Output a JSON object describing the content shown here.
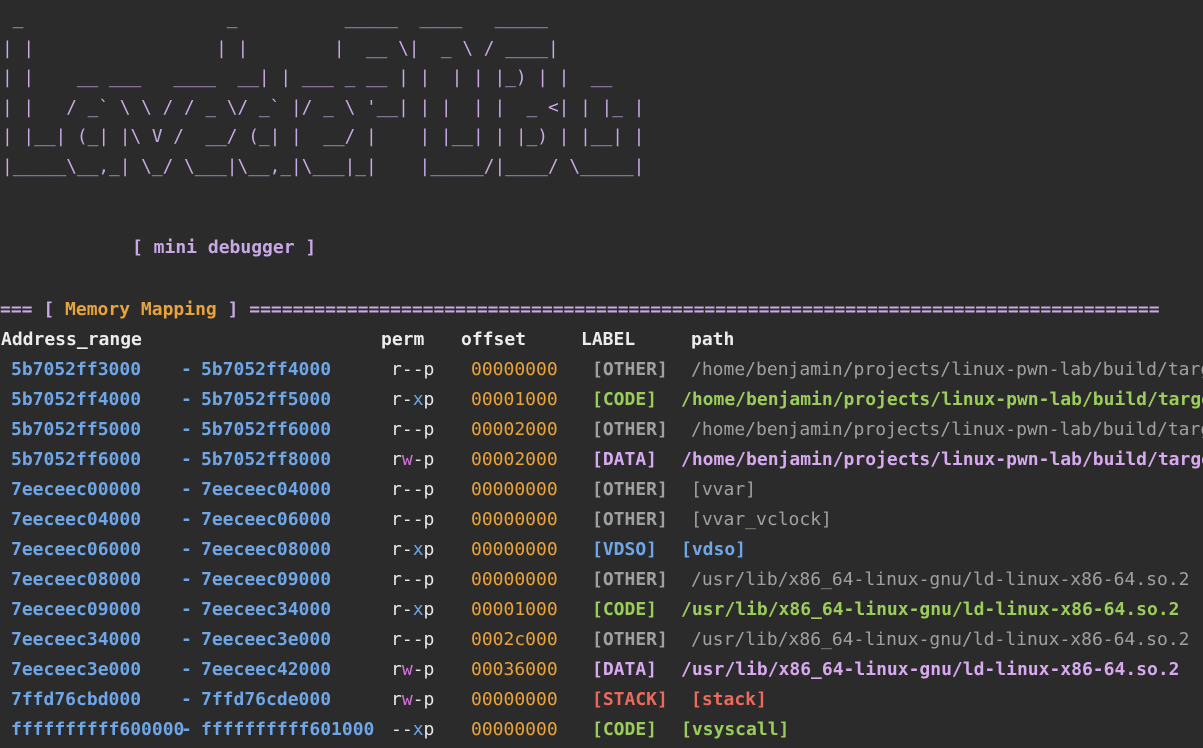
{
  "banner": " _                   _          _____  ____   _____\n| |                 | |        |  __ \\|  _ \\ / ____|\n| |    __ ___   ____  __| | ___ _ __ | |  | | |_) | |  __\n| |   / _` \\ \\ / / _ \\/ _` |/ _ \\ '__| | |  | |  _ <| | |_ |\n| |__| (_| |\\ V /  __/ (_| |  __/ |    | |__| | |_) | |__| |\n|_____\\__,_| \\_/ \\___|\\__,_|\\___|_|    |_____/|____/ \\_____|",
  "subtitle": "[ mini debugger ]",
  "section": {
    "prefix": "=== [ ",
    "title": "Memory Mapping",
    "suffix": " ] ===================================================================================="
  },
  "headers": {
    "address_range": "Address_range",
    "perm": "perm",
    "offset": "offset",
    "label": "LABEL",
    "path": "path"
  },
  "colors": {
    "background": "#2b2b2b",
    "address": "#6ea6e8",
    "offset": "#e8a33c",
    "other": "#a0a0a0",
    "code": "#9acd5a",
    "data": "#d8a8f0",
    "vdso": "#6ea6e8",
    "stack": "#ec6a5c",
    "banner": "#c9a8e6"
  },
  "mappings": [
    {
      "start": "5b7052ff3000",
      "end": "5b7052ff4000",
      "perm": "r--p",
      "offset": "00000000",
      "label": "[OTHER]",
      "type": "OTHER",
      "path": "/home/benjamin/projects/linux-pwn-lab/build/target"
    },
    {
      "start": "5b7052ff4000",
      "end": "5b7052ff5000",
      "perm": "r-xp",
      "offset": "00001000",
      "label": "[CODE]",
      "type": "CODE",
      "path": "/home/benjamin/projects/linux-pwn-lab/build/target"
    },
    {
      "start": "5b7052ff5000",
      "end": "5b7052ff6000",
      "perm": "r--p",
      "offset": "00002000",
      "label": "[OTHER]",
      "type": "OTHER",
      "path": "/home/benjamin/projects/linux-pwn-lab/build/target"
    },
    {
      "start": "5b7052ff6000",
      "end": "5b7052ff8000",
      "perm": "rw-p",
      "offset": "00002000",
      "label": "[DATA]",
      "type": "DATA",
      "path": "/home/benjamin/projects/linux-pwn-lab/build/target"
    },
    {
      "start": "7eeceec00000",
      "end": "7eeceec04000",
      "perm": "r--p",
      "offset": "00000000",
      "label": "[OTHER]",
      "type": "OTHER",
      "path": "[vvar]"
    },
    {
      "start": "7eeceec04000",
      "end": "7eeceec06000",
      "perm": "r--p",
      "offset": "00000000",
      "label": "[OTHER]",
      "type": "OTHER",
      "path": "[vvar_vclock]"
    },
    {
      "start": "7eeceec06000",
      "end": "7eeceec08000",
      "perm": "r-xp",
      "offset": "00000000",
      "label": "[VDSO]",
      "type": "VDSO",
      "path": "[vdso]"
    },
    {
      "start": "7eeceec08000",
      "end": "7eeceec09000",
      "perm": "r--p",
      "offset": "00000000",
      "label": "[OTHER]",
      "type": "OTHER",
      "path": "/usr/lib/x86_64-linux-gnu/ld-linux-x86-64.so.2"
    },
    {
      "start": "7eeceec09000",
      "end": "7eeceec34000",
      "perm": "r-xp",
      "offset": "00001000",
      "label": "[CODE]",
      "type": "CODE",
      "path": "/usr/lib/x86_64-linux-gnu/ld-linux-x86-64.so.2"
    },
    {
      "start": "7eeceec34000",
      "end": "7eeceec3e000",
      "perm": "r--p",
      "offset": "0002c000",
      "label": "[OTHER]",
      "type": "OTHER",
      "path": "/usr/lib/x86_64-linux-gnu/ld-linux-x86-64.so.2"
    },
    {
      "start": "7eeceec3e000",
      "end": "7eeceec42000",
      "perm": "rw-p",
      "offset": "00036000",
      "label": "[DATA]",
      "type": "DATA",
      "path": "/usr/lib/x86_64-linux-gnu/ld-linux-x86-64.so.2"
    },
    {
      "start": "7ffd76cbd000",
      "end": "7ffd76cde000",
      "perm": "rw-p",
      "offset": "00000000",
      "label": "[STACK]",
      "type": "STACK",
      "path": "[stack]"
    },
    {
      "start": "ffffffffff600000",
      "end": "ffffffffff601000",
      "perm": "--xp",
      "offset": "00000000",
      "label": "[CODE]",
      "type": "CODE",
      "path": "[vsyscall]"
    }
  ]
}
